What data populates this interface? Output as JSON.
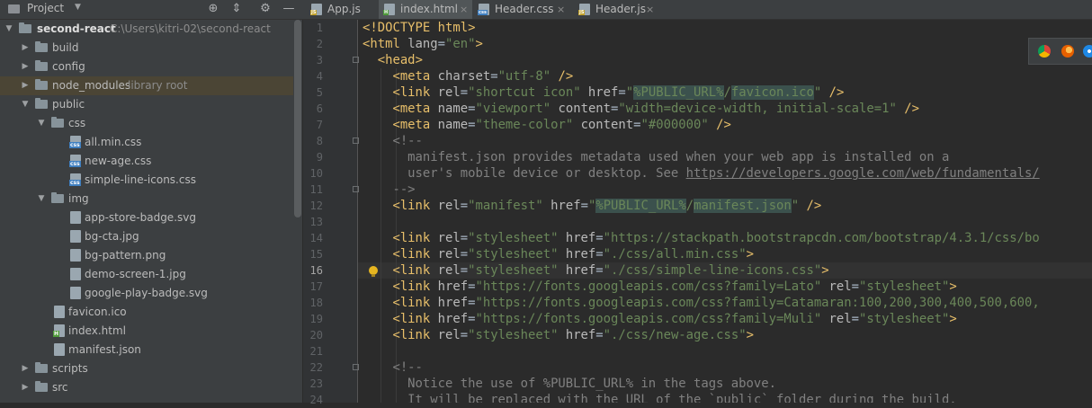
{
  "sidebar": {
    "title": "Project",
    "tools": [
      "target-icon",
      "collapse-icon",
      "gear-icon",
      "minimize-icon"
    ],
    "tree": [
      {
        "label": "second-react",
        "extra": "C:\\Users\\kitri-02\\second-react",
        "type": "folder",
        "expanded": true
      },
      {
        "label": "build",
        "type": "folder",
        "expanded": false
      },
      {
        "label": "config",
        "type": "folder",
        "expanded": false
      },
      {
        "label": "node_modules",
        "extra": "library root",
        "type": "folder",
        "expanded": false
      },
      {
        "label": "public",
        "type": "folder",
        "expanded": true
      },
      {
        "label": "css",
        "type": "folder",
        "expanded": true
      },
      {
        "label": "all.min.css",
        "type": "css"
      },
      {
        "label": "new-age.css",
        "type": "css"
      },
      {
        "label": "simple-line-icons.css",
        "type": "css"
      },
      {
        "label": "img",
        "type": "folder",
        "expanded": true
      },
      {
        "label": "app-store-badge.svg",
        "type": "file"
      },
      {
        "label": "bg-cta.jpg",
        "type": "file"
      },
      {
        "label": "bg-pattern.png",
        "type": "file"
      },
      {
        "label": "demo-screen-1.jpg",
        "type": "file"
      },
      {
        "label": "google-play-badge.svg",
        "type": "file"
      },
      {
        "label": "favicon.ico",
        "type": "file"
      },
      {
        "label": "index.html",
        "type": "html"
      },
      {
        "label": "manifest.json",
        "type": "file"
      },
      {
        "label": "scripts",
        "type": "folder",
        "expanded": false
      },
      {
        "label": "src",
        "type": "folder",
        "expanded": false
      }
    ]
  },
  "tabs": [
    {
      "label": "App.js",
      "file_type": "js",
      "active": false
    },
    {
      "label": "index.html",
      "file_type": "html",
      "active": true
    },
    {
      "label": "Header.css",
      "file_type": "css",
      "active": false
    },
    {
      "label": "Header.js",
      "file_type": "js",
      "active": false
    }
  ],
  "editor": {
    "current_line": 16,
    "line_numbers": [
      "1",
      "2",
      "3",
      "4",
      "5",
      "6",
      "7",
      "8",
      "9",
      "10",
      "11",
      "12",
      "13",
      "14",
      "15",
      "16",
      "17",
      "18",
      "19",
      "20",
      "21",
      "22",
      "23",
      "24"
    ],
    "lines": [
      "<!DOCTYPE html>",
      "<html lang=\"en\">",
      "  <head>",
      "    <meta charset=\"utf-8\" />",
      "    <link rel=\"shortcut icon\" href=\"%PUBLIC_URL%/favicon.ico\" />",
      "    <meta name=\"viewport\" content=\"width=device-width, initial-scale=1\" />",
      "    <meta name=\"theme-color\" content=\"#000000\" />",
      "    <!--",
      "      manifest.json provides metadata used when your web app is installed on a",
      "      user's mobile device or desktop. See https://developers.google.com/web/fundamentals/",
      "    -->",
      "    <link rel=\"manifest\" href=\"%PUBLIC_URL%/manifest.json\" />",
      "",
      "    <link rel=\"stylesheet\" href=\"https://stackpath.bootstrapcdn.com/bootstrap/4.3.1/css/bo",
      "    <link rel=\"stylesheet\" href=\"./css/all.min.css\">",
      "    <link rel=\"stylesheet\" href=\"./css/simple-line-icons.css\">",
      "    <link href=\"https://fonts.googleapis.com/css?family=Lato\" rel=\"stylesheet\">",
      "    <link href=\"https://fonts.googleapis.com/css?family=Catamaran:100,200,300,400,500,600,",
      "    <link href=\"https://fonts.googleapis.com/css?family=Muli\" rel=\"stylesheet\">",
      "    <link rel=\"stylesheet\" href=\"./css/new-age.css\">",
      "",
      "    <!--",
      "      Notice the use of %PUBLIC_URL% in the tags above.",
      "      It will be replaced with the URL of the `public` folder during the build."
    ]
  },
  "browsers": [
    "chrome-icon",
    "firefox-icon",
    "safari-icon"
  ]
}
